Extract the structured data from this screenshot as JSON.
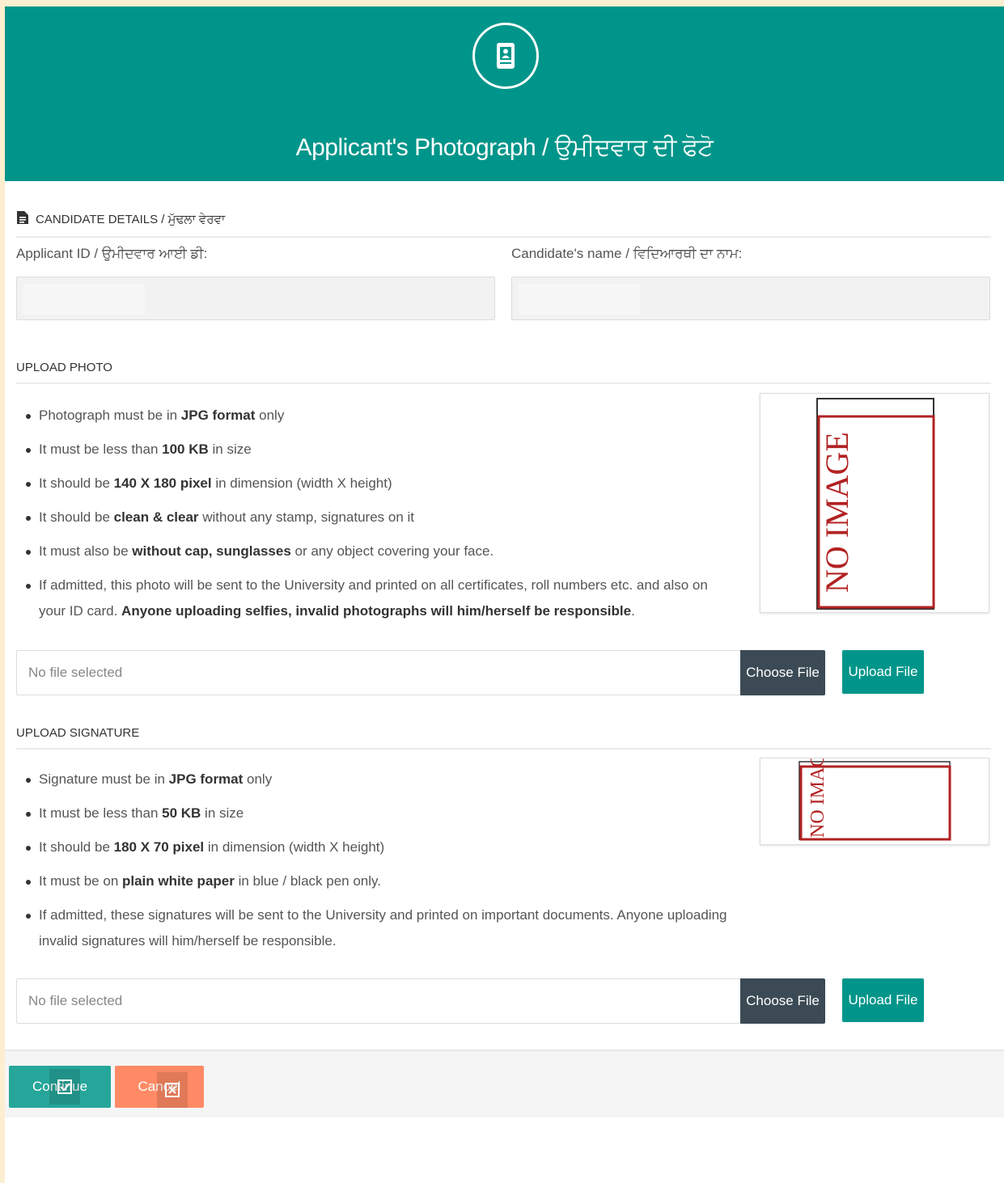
{
  "header": {
    "icon": "id-card-icon",
    "title": "Applicant's Photograph / ਉਮੀਦਵਾਰ ਦੀ ਫੋਟੋ"
  },
  "candidate": {
    "section_icon": "document-icon",
    "section_title": "CANDIDATE DETAILS / ਮੁੱਢਲਾ ਵੇਰਵਾ",
    "applicant_id_label": "Applicant ID / ਉਮੀਦਵਾਰ ਆਈ ਡੀ:",
    "applicant_id_value": "",
    "candidate_name_label": "Candidate's name / ਵਿਦਿਆਰਥੀ ਦਾ ਨਾਮ:",
    "candidate_name_value": ""
  },
  "photo": {
    "section_title": "UPLOAD PHOTO",
    "rules": [
      {
        "pre": "Photograph must be in ",
        "bold": "JPG format",
        "post": " only"
      },
      {
        "pre": "It must be less than ",
        "bold": "100 KB",
        "post": " in size"
      },
      {
        "pre": "It should be ",
        "bold": "140 X 180 pixel",
        "post": " in dimension (width X height)"
      },
      {
        "pre": "It should be ",
        "bold": "clean & clear",
        "post": " without any stamp, signatures on it"
      },
      {
        "pre": "It must also be ",
        "bold": "without cap, sunglasses",
        "post": " or any object covering your face."
      },
      {
        "pre": "If admitted, this photo will be sent to the University and printed on all certificates, roll numbers etc. and also on your ID card. ",
        "bold": "Anyone uploading selfies, invalid photographs will him/herself be responsible",
        "post": "."
      }
    ],
    "preview_text": "NO IMAGE",
    "file_placeholder": "No file selected",
    "choose_label": "Choose File",
    "upload_label": "Upload File"
  },
  "signature": {
    "section_title": "UPLOAD SIGNATURE",
    "rules": [
      {
        "pre": "Signature must be in ",
        "bold": "JPG format",
        "post": " only"
      },
      {
        "pre": "It must be less than ",
        "bold": "50 KB",
        "post": " in size"
      },
      {
        "pre": "It should be ",
        "bold": "180 X 70 pixel",
        "post": " in dimension (width X height)"
      },
      {
        "pre": "It must be on ",
        "bold": "plain white paper",
        "post": " in blue / black pen only."
      },
      {
        "pre": "If admitted, these signatures will be sent to the University and printed on important documents. Anyone uploading invalid signatures will him/herself be responsible.",
        "bold": "",
        "post": ""
      }
    ],
    "preview_text": "NO IMAGE",
    "file_placeholder": "No file selected",
    "choose_label": "Choose File",
    "upload_label": "Upload File"
  },
  "footer": {
    "continue_label": "Continue",
    "continue_icon": "check-square-icon",
    "cancel_label": "Cancel",
    "cancel_icon": "close-square-icon"
  },
  "colors": {
    "brand": "#00958a",
    "dark_button": "#3b4a54",
    "cancel": "#ff8a65",
    "page_bg": "#fbefcf",
    "no_image_red": "#b22222"
  }
}
